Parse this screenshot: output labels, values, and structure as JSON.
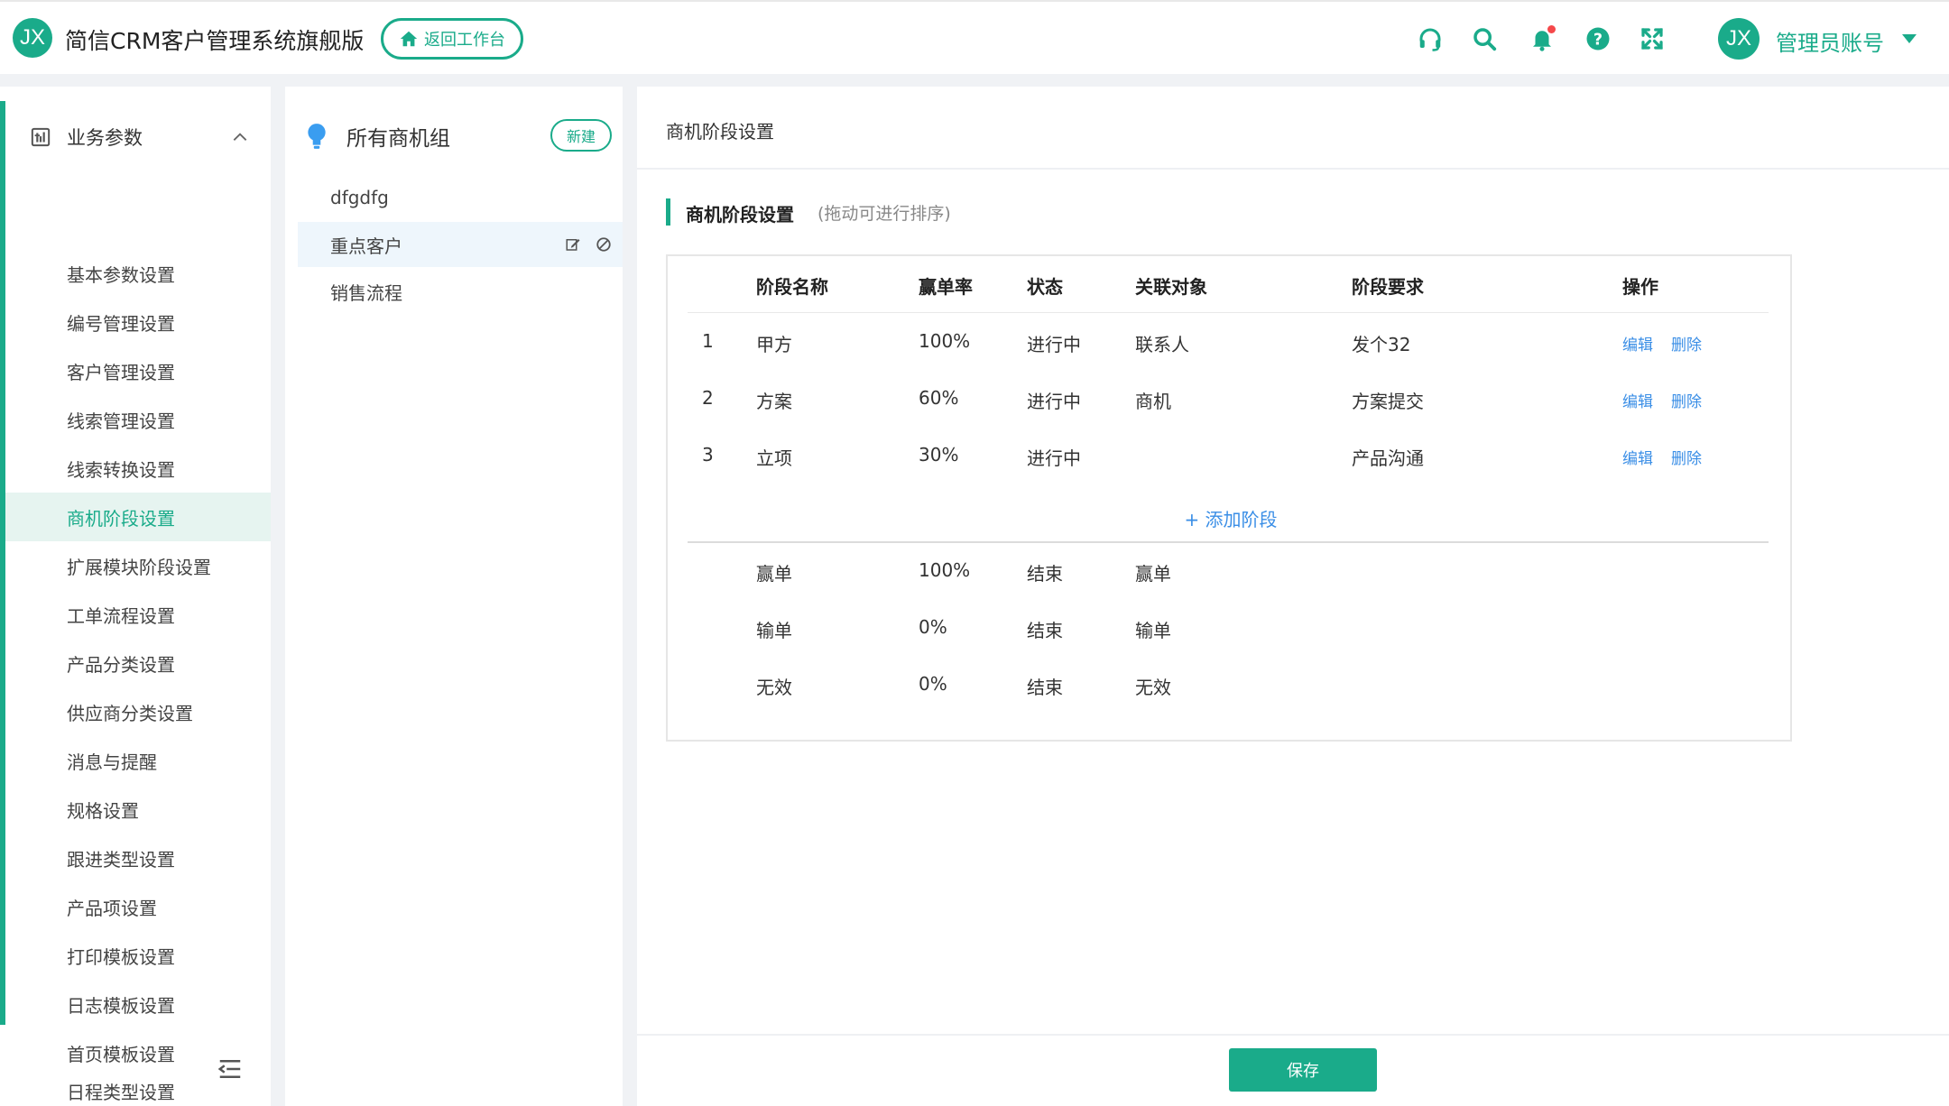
{
  "header": {
    "logo_text": "JX",
    "app_title": "简信CRM客户管理系统旗舰版",
    "back_label": "返回工作台",
    "avatar_text": "JX",
    "user_name": "管理员账号",
    "icons": [
      "headset-icon",
      "search-icon",
      "bell-icon",
      "help-icon",
      "fullscreen-icon"
    ],
    "accent_color": "#1aab8a",
    "notification_dot_color": "#f5484a"
  },
  "sidebar": {
    "group_label": "业务参数",
    "items": [
      {
        "label": "基本参数设置"
      },
      {
        "label": "编号管理设置"
      },
      {
        "label": "客户管理设置"
      },
      {
        "label": "线索管理设置"
      },
      {
        "label": "线索转换设置"
      },
      {
        "label": "商机阶段设置",
        "active": true
      },
      {
        "label": "扩展模块阶段设置"
      },
      {
        "label": "工单流程设置"
      },
      {
        "label": "产品分类设置"
      },
      {
        "label": "供应商分类设置"
      },
      {
        "label": "消息与提醒"
      },
      {
        "label": "规格设置"
      },
      {
        "label": "跟进类型设置"
      },
      {
        "label": "产品项设置"
      },
      {
        "label": "打印模板设置"
      },
      {
        "label": "日志模板设置"
      },
      {
        "label": "首页模板设置"
      },
      {
        "label": "日程类型设置"
      }
    ]
  },
  "groups": {
    "title": "所有商机组",
    "new_label": "新建",
    "items": [
      {
        "label": "dfgdfg"
      },
      {
        "label": "重点客户",
        "active": true
      },
      {
        "label": "销售流程"
      }
    ]
  },
  "main": {
    "page_title": "商机阶段设置",
    "section_title": "商机阶段设置",
    "section_hint": "(拖动可进行排序)",
    "columns": [
      "阶段名称",
      "赢单率",
      "状态",
      "关联对象",
      "阶段要求",
      "操作"
    ],
    "stages": [
      {
        "index": "1",
        "name": "甲方",
        "rate": "100%",
        "status": "进行中",
        "object": "联系人",
        "requirement": "发个32"
      },
      {
        "index": "2",
        "name": "方案",
        "rate": "60%",
        "status": "进行中",
        "object": "商机",
        "requirement": "方案提交"
      },
      {
        "index": "3",
        "name": "立项",
        "rate": "30%",
        "status": "进行中",
        "object": "",
        "requirement": "产品沟通"
      }
    ],
    "edit_label": "编辑",
    "delete_label": "删除",
    "add_stage_label": "+ 添加阶段",
    "final_stages": [
      {
        "name": "赢单",
        "rate": "100%",
        "status": "结束",
        "object": "赢单"
      },
      {
        "name": "输单",
        "rate": "0%",
        "status": "结束",
        "object": "输单"
      },
      {
        "name": "无效",
        "rate": "0%",
        "status": "结束",
        "object": "无效"
      }
    ],
    "save_label": "保存",
    "link_color": "#3a8ee6"
  }
}
